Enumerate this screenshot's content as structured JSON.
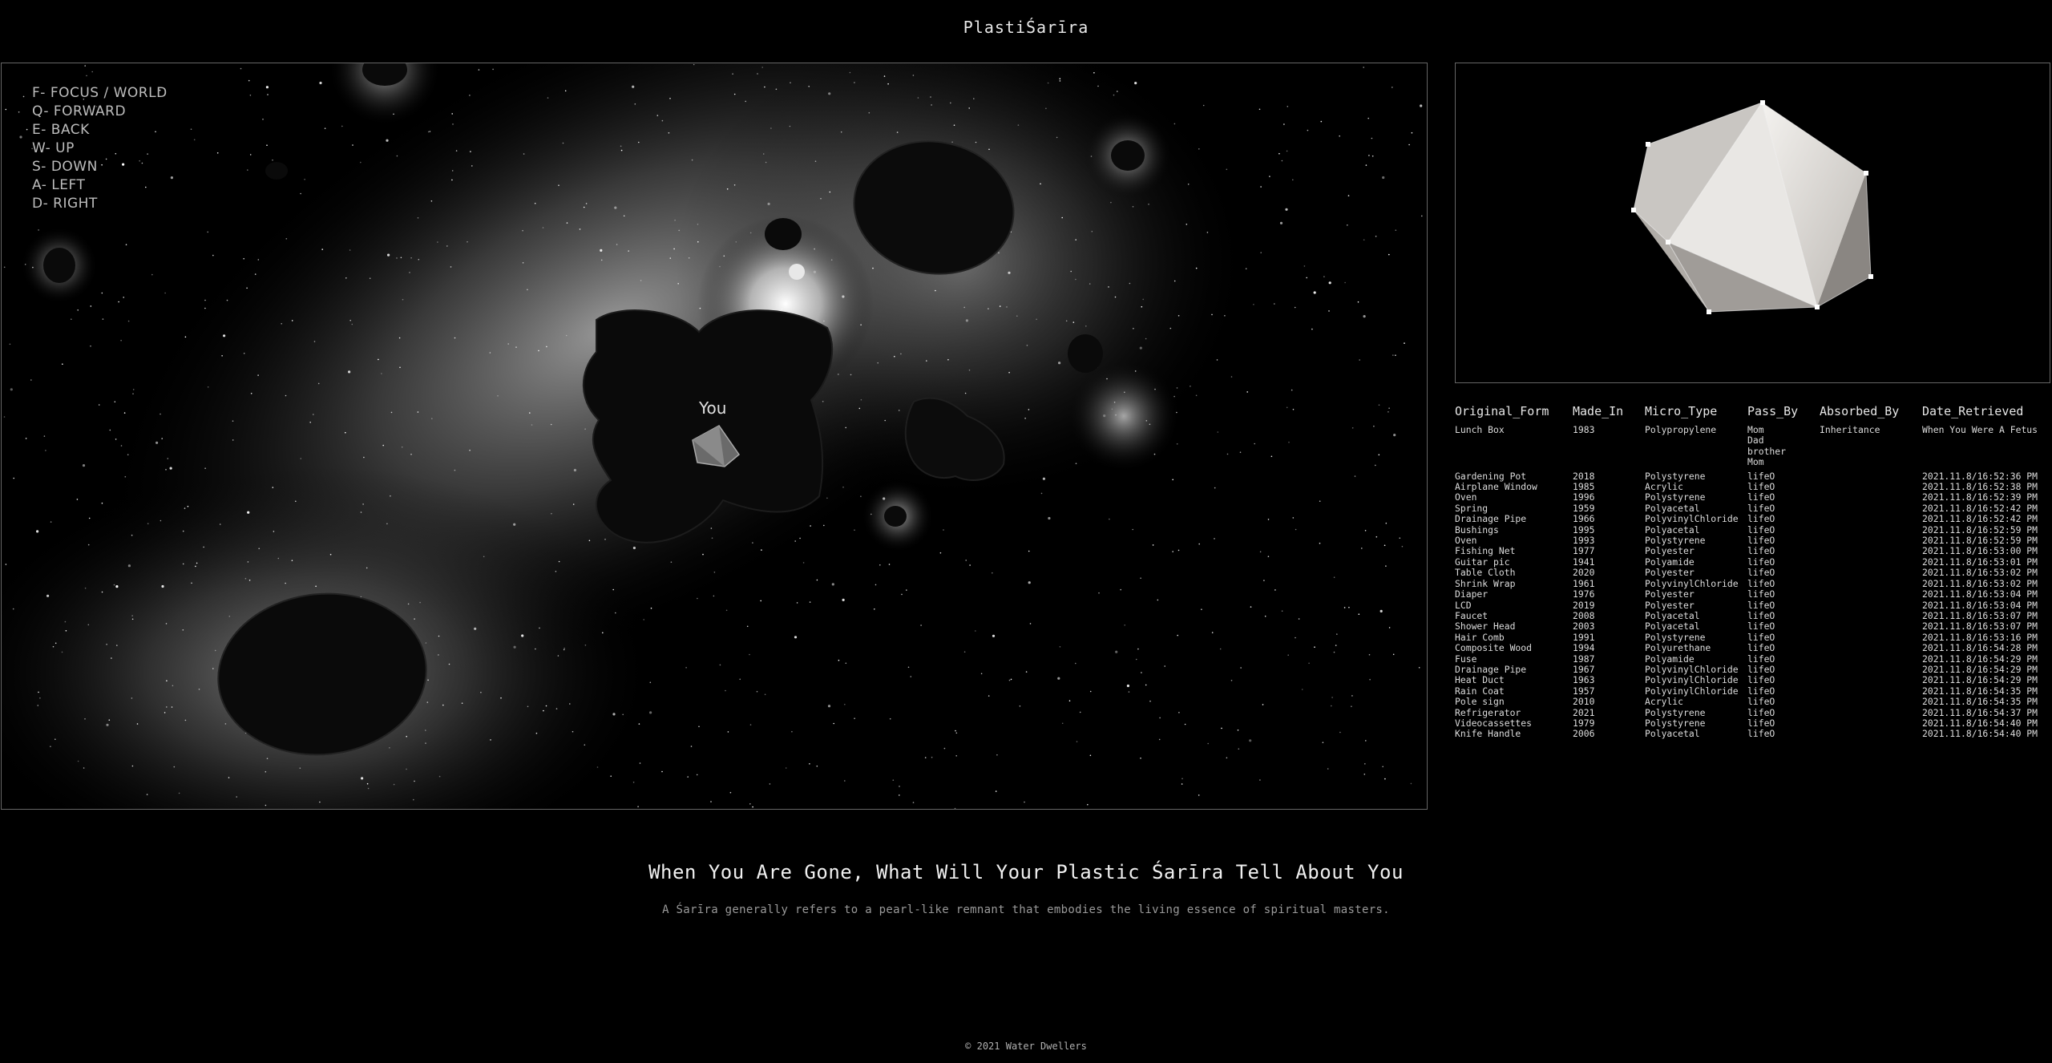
{
  "header": {
    "title": "PlastiŚarīra"
  },
  "controls": [
    "F- FOCUS / WORLD",
    "Q- FORWARD",
    "E- BACK",
    "W- UP",
    "S- DOWN",
    "A- LEFT",
    "D- RIGHT"
  ],
  "scene": {
    "you_label": "You"
  },
  "table": {
    "headers": [
      "Original_Form",
      "Made_In",
      "Micro_Type",
      "Pass_By",
      "Absorbed_By",
      "Date_Retrieved"
    ],
    "first_row": {
      "original_form": "Lunch Box",
      "made_in": "1983",
      "micro_type": "Polypropylene",
      "pass_by": [
        "Mom",
        "Dad",
        "brother",
        "Mom"
      ],
      "absorbed_by": "Inheritance",
      "date_retrieved": "When You Were A Fetus"
    },
    "rows": [
      [
        "Gardening Pot",
        "2018",
        "Polystyrene",
        "lifeO",
        "",
        "2021.11.8/16:52:36 PM"
      ],
      [
        "Airplane Window",
        "1985",
        "Acrylic",
        "lifeO",
        "",
        "2021.11.8/16:52:38 PM"
      ],
      [
        "Oven",
        "1996",
        "Polystyrene",
        "lifeO",
        "",
        "2021.11.8/16:52:39 PM"
      ],
      [
        "Spring",
        "1959",
        "Polyacetal",
        "lifeO",
        "",
        "2021.11.8/16:52:42 PM"
      ],
      [
        "Drainage Pipe",
        "1966",
        "PolyvinylChloride",
        "lifeO",
        "",
        "2021.11.8/16:52:42 PM"
      ],
      [
        "Bushings",
        "1995",
        "Polyacetal",
        "lifeO",
        "",
        "2021.11.8/16:52:59 PM"
      ],
      [
        "Oven",
        "1993",
        "Polystyrene",
        "lifeO",
        "",
        "2021.11.8/16:52:59 PM"
      ],
      [
        "Fishing Net",
        "1977",
        "Polyester",
        "lifeO",
        "",
        "2021.11.8/16:53:00 PM"
      ],
      [
        "Guitar pic",
        "1941",
        "Polyamide",
        "lifeO",
        "",
        "2021.11.8/16:53:01 PM"
      ],
      [
        "Table Cloth",
        "2020",
        "Polyester",
        "lifeO",
        "",
        "2021.11.8/16:53:02 PM"
      ],
      [
        "Shrink Wrap",
        "1961",
        "PolyvinylChloride",
        "lifeO",
        "",
        "2021.11.8/16:53:02 PM"
      ],
      [
        "Diaper",
        "1976",
        "Polyester",
        "lifeO",
        "",
        "2021.11.8/16:53:04 PM"
      ],
      [
        "LCD",
        "2019",
        "Polyester",
        "lifeO",
        "",
        "2021.11.8/16:53:04 PM"
      ],
      [
        "Faucet",
        "2008",
        "Polyacetal",
        "lifeO",
        "",
        "2021.11.8/16:53:07 PM"
      ],
      [
        "Shower Head",
        "2003",
        "Polyacetal",
        "lifeO",
        "",
        "2021.11.8/16:53:07 PM"
      ],
      [
        "Hair Comb",
        "1991",
        "Polystyrene",
        "lifeO",
        "",
        "2021.11.8/16:53:16 PM"
      ],
      [
        "Composite Wood",
        "1994",
        "Polyurethane",
        "lifeO",
        "",
        "2021.11.8/16:54:28 PM"
      ],
      [
        "Fuse",
        "1987",
        "Polyamide",
        "lifeO",
        "",
        "2021.11.8/16:54:29 PM"
      ],
      [
        "Drainage Pipe",
        "1967",
        "PolyvinylChloride",
        "lifeO",
        "",
        "2021.11.8/16:54:29 PM"
      ],
      [
        "Heat Duct",
        "1963",
        "PolyvinylChloride",
        "lifeO",
        "",
        "2021.11.8/16:54:29 PM"
      ],
      [
        "Rain Coat",
        "1957",
        "PolyvinylChloride",
        "lifeO",
        "",
        "2021.11.8/16:54:35 PM"
      ],
      [
        "Pole sign",
        "2010",
        "Acrylic",
        "lifeO",
        "",
        "2021.11.8/16:54:35 PM"
      ],
      [
        "Refrigerator",
        "2021",
        "Polystyrene",
        "lifeO",
        "",
        "2021.11.8/16:54:37 PM"
      ],
      [
        "Videocassettes",
        "1979",
        "Polystyrene",
        "lifeO",
        "",
        "2021.11.8/16:54:40 PM"
      ],
      [
        "Knife Handle",
        "2006",
        "Polyacetal",
        "lifeO",
        "",
        "2021.11.8/16:54:40 PM"
      ]
    ]
  },
  "headline": "When You Are Gone, What Will Your Plastic Śarīra Tell About You",
  "subline": "A Śarīra generally refers to a pearl-like remnant that embodies the living essence of spiritual masters.",
  "footer": "© 2021 Water Dwellers",
  "colors": {
    "background": "#000000",
    "frame": "#666666",
    "text": "#d8d8d8"
  }
}
